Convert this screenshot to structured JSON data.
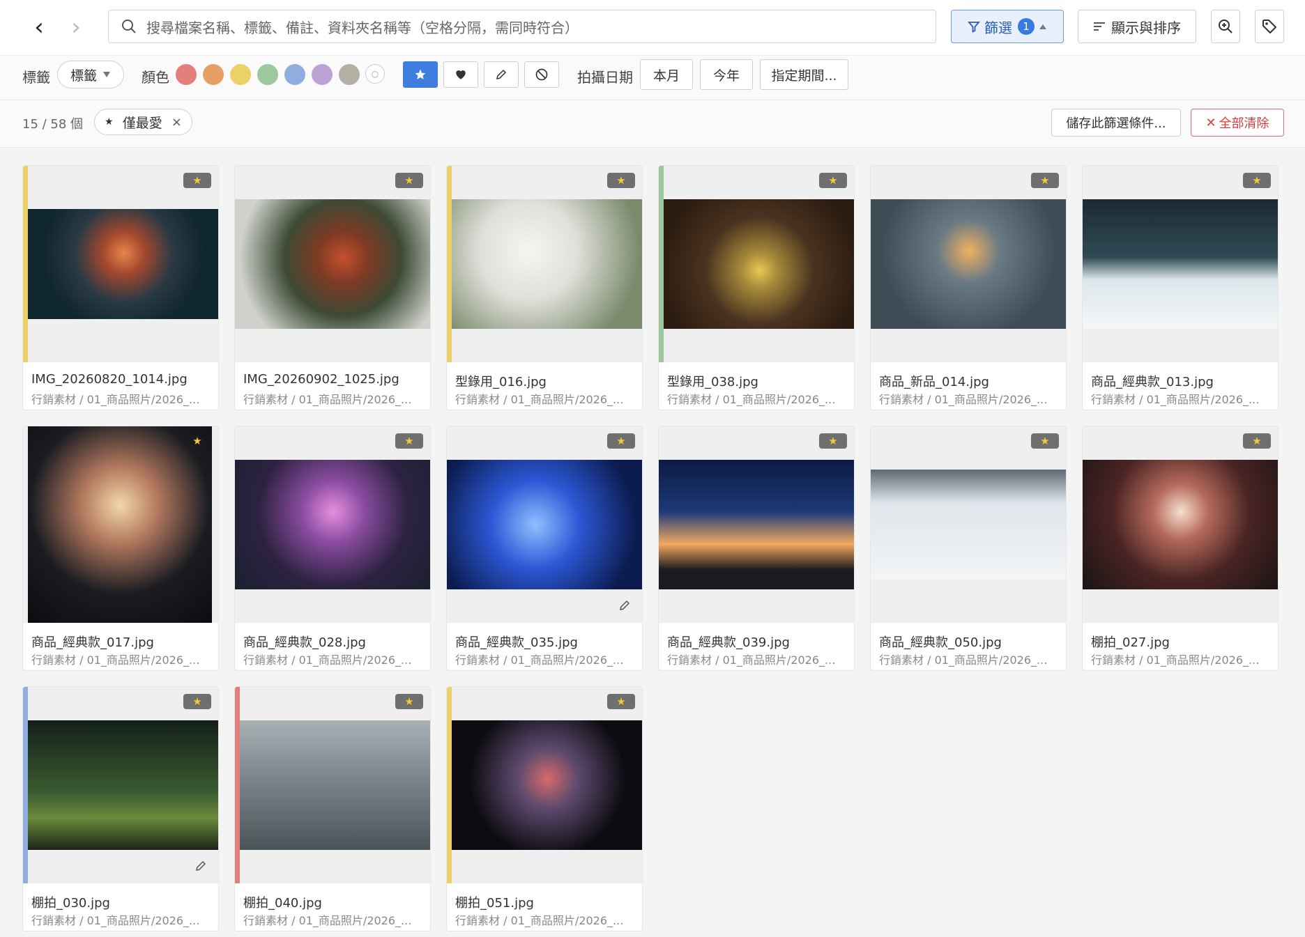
{
  "header": {
    "back_icon": "‹",
    "forward_icon": "›",
    "search_placeholder": "搜尋檔案名稱、標籤、備註、資料夾名稱等（空格分隔，需同時符合）",
    "filter_label": "篩選",
    "filter_count": "1",
    "display_sort_label": "顯示與排序"
  },
  "filters": {
    "tag_label": "標籤",
    "tag_dropdown": "標籤",
    "color_label": "顏色",
    "colors": [
      "#e27f7c",
      "#e6a066",
      "#ebd168",
      "#9dc79d",
      "#8fadde",
      "#bca3d4",
      "#b5b0a4"
    ],
    "type_buttons": [
      "star-icon",
      "heart-icon",
      "pencil-icon",
      "ban-icon"
    ],
    "date_label": "拍攝日期",
    "this_month": "本月",
    "this_year": "今年",
    "range": "指定期間..."
  },
  "summary": {
    "count": "15 / 58 個",
    "chip_label": "僅最愛",
    "chip_close": "×",
    "save_label": "儲存此篩選條件...",
    "clear_label": "全部清除"
  },
  "items": [
    {
      "name": "IMG_20260820_1014.jpg",
      "path": "行銷素材 / 01_商品照片/2026_...",
      "color": "#ebd168",
      "fav": true,
      "edit": false
    },
    {
      "name": "IMG_20260902_1025.jpg",
      "path": "行銷素材 / 01_商品照片/2026_...",
      "color": "",
      "fav": true,
      "edit": false
    },
    {
      "name": "型錄用_016.jpg",
      "path": "行銷素材 / 01_商品照片/2026_...",
      "color": "#ebd168",
      "fav": true,
      "edit": false
    },
    {
      "name": "型錄用_038.jpg",
      "path": "行銷素材 / 01_商品照片/2026_...",
      "color": "#9dc79d",
      "fav": true,
      "edit": false
    },
    {
      "name": "商品_新品_014.jpg",
      "path": "行銷素材 / 01_商品照片/2026_...",
      "color": "",
      "fav": true,
      "edit": false
    },
    {
      "name": "商品_經典款_013.jpg",
      "path": "行銷素材 / 01_商品照片/2026_...",
      "color": "",
      "fav": true,
      "edit": false
    },
    {
      "name": "商品_經典款_017.jpg",
      "path": "行銷素材 / 01_商品照片/2026_...",
      "color": "",
      "fav": true,
      "edit": false
    },
    {
      "name": "商品_經典款_028.jpg",
      "path": "行銷素材 / 01_商品照片/2026_...",
      "color": "",
      "fav": true,
      "edit": false
    },
    {
      "name": "商品_經典款_035.jpg",
      "path": "行銷素材 / 01_商品照片/2026_...",
      "color": "",
      "fav": true,
      "edit": true
    },
    {
      "name": "商品_經典款_039.jpg",
      "path": "行銷素材 / 01_商品照片/2026_...",
      "color": "",
      "fav": true,
      "edit": false
    },
    {
      "name": "商品_經典款_050.jpg",
      "path": "行銷素材 / 01_商品照片/2026_...",
      "color": "",
      "fav": true,
      "edit": false
    },
    {
      "name": "棚拍_027.jpg",
      "path": "行銷素材 / 01_商品照片/2026_...",
      "color": "",
      "fav": true,
      "edit": false
    },
    {
      "name": "棚拍_030.jpg",
      "path": "行銷素材 / 01_商品照片/2026_...",
      "color": "#8fadde",
      "fav": true,
      "edit": true
    },
    {
      "name": "棚拍_040.jpg",
      "path": "行銷素材 / 01_商品照片/2026_...",
      "color": "#e27f7c",
      "fav": true,
      "edit": false
    },
    {
      "name": "棚拍_051.jpg",
      "path": "行銷素材 / 01_商品照片/2026_...",
      "color": "#ebd168",
      "fav": true,
      "edit": false
    }
  ]
}
